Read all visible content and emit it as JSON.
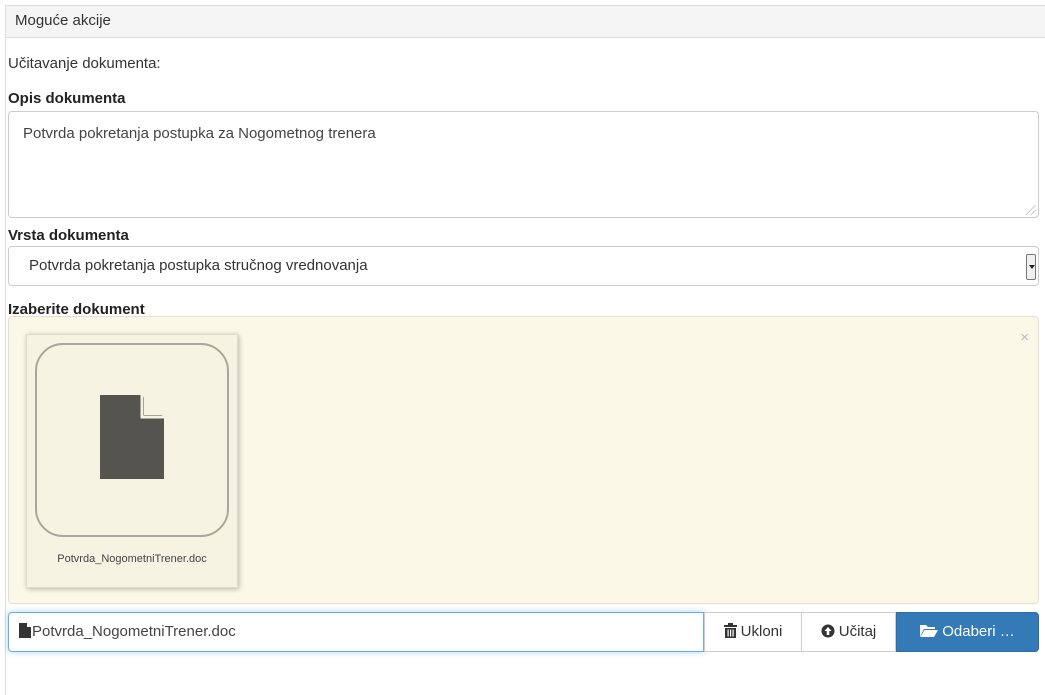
{
  "panel": {
    "heading": "Moguće akcije",
    "loading_label": "Učitavanje dokumenta:"
  },
  "description": {
    "label": "Opis dokumenta",
    "value": "Potvrda pokretanja postupka za Nogometnog trenera"
  },
  "doc_type": {
    "label": "Vrsta dokumenta",
    "selected": "Potvrda pokretanja postupka stručnog vrednovanja"
  },
  "file_picker": {
    "label": "Izaberite dokument",
    "close_symbol": "×",
    "preview_filename": "Potvrda_NogometniTrener.doc",
    "caption_filename": "Potvrda_NogometniTrener.doc",
    "remove_label": "Ukloni",
    "upload_label": "Učitaj",
    "browse_label": "Odaberi …"
  },
  "icons": {
    "file": "file-icon",
    "trash": "trash-icon",
    "upload": "upload-circle-icon",
    "folder": "folder-open-icon"
  },
  "colors": {
    "primary": "#337ab7",
    "preview_bg": "#fcf8e8",
    "focus_border": "#66afe9"
  }
}
